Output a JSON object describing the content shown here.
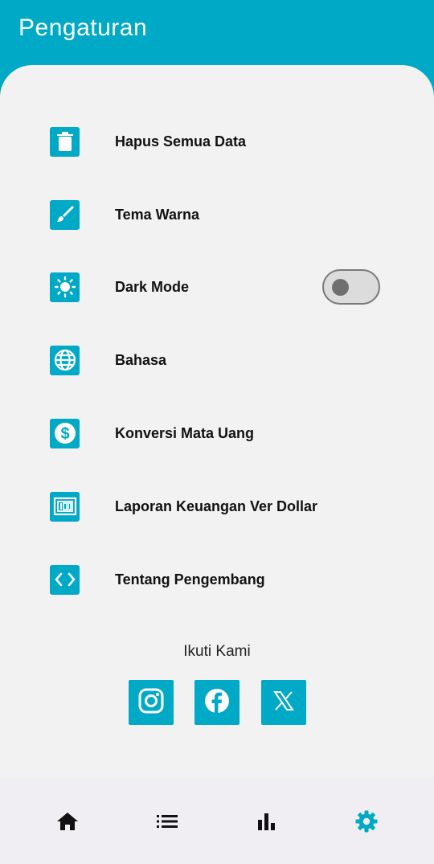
{
  "header": {
    "title": "Pengaturan"
  },
  "menu": {
    "items": [
      {
        "label": "Hapus Semua Data",
        "icon": "trash-icon"
      },
      {
        "label": "Tema Warna",
        "icon": "brush-icon"
      },
      {
        "label": "Dark Mode",
        "icon": "brightness-icon",
        "toggle": false
      },
      {
        "label": "Bahasa",
        "icon": "globe-icon"
      },
      {
        "label": "Konversi Mata Uang",
        "icon": "dollar-icon"
      },
      {
        "label": "Laporan Keuangan Ver Dollar",
        "icon": "currency-report-icon"
      },
      {
        "label": "Tentang Pengembang",
        "icon": "code-icon"
      }
    ]
  },
  "social": {
    "title": "Ikuti Kami",
    "links": [
      {
        "icon": "instagram-icon"
      },
      {
        "icon": "facebook-icon"
      },
      {
        "icon": "x-icon"
      }
    ]
  },
  "bottom_nav": {
    "items": [
      {
        "icon": "home-icon",
        "active": false
      },
      {
        "icon": "list-icon",
        "active": false
      },
      {
        "icon": "bar-chart-icon",
        "active": false
      },
      {
        "icon": "settings-icon",
        "active": true
      }
    ]
  },
  "colors": {
    "primary": "#00a9c5",
    "background": "#f2f2f2",
    "nav_background": "#f0edf3",
    "text": "#111111"
  }
}
